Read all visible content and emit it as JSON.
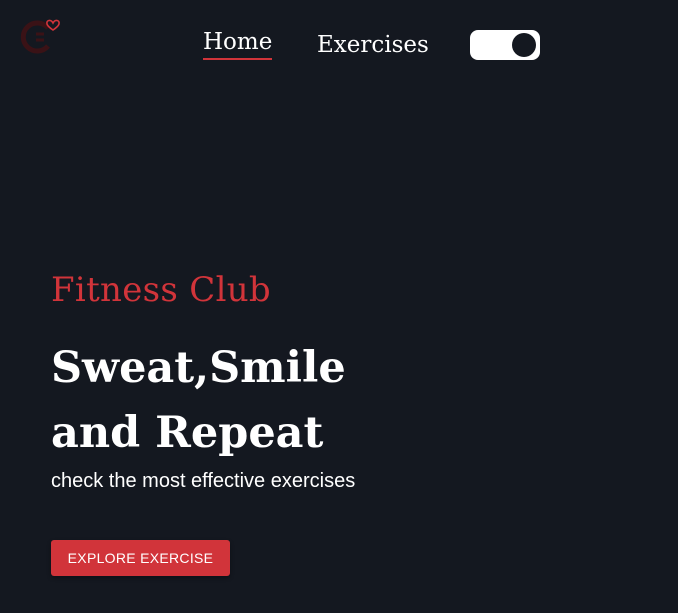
{
  "header": {
    "logo_icon": "dumbbell-heart-logo",
    "nav": [
      {
        "label": "Home",
        "active": true
      },
      {
        "label": "Exercises",
        "active": false
      }
    ],
    "theme_toggle": {
      "icon": "toggle-switch",
      "state": "on"
    }
  },
  "hero": {
    "eyebrow": "Fitness Club",
    "title_line1": "Sweat,Smile",
    "title_line2": "and Repeat",
    "subtitle": "check the most effective exercises",
    "cta_label": "EXPLORE EXERCISE"
  },
  "colors": {
    "background": "#141820",
    "accent": "#d1343a",
    "text": "#ffffff"
  }
}
